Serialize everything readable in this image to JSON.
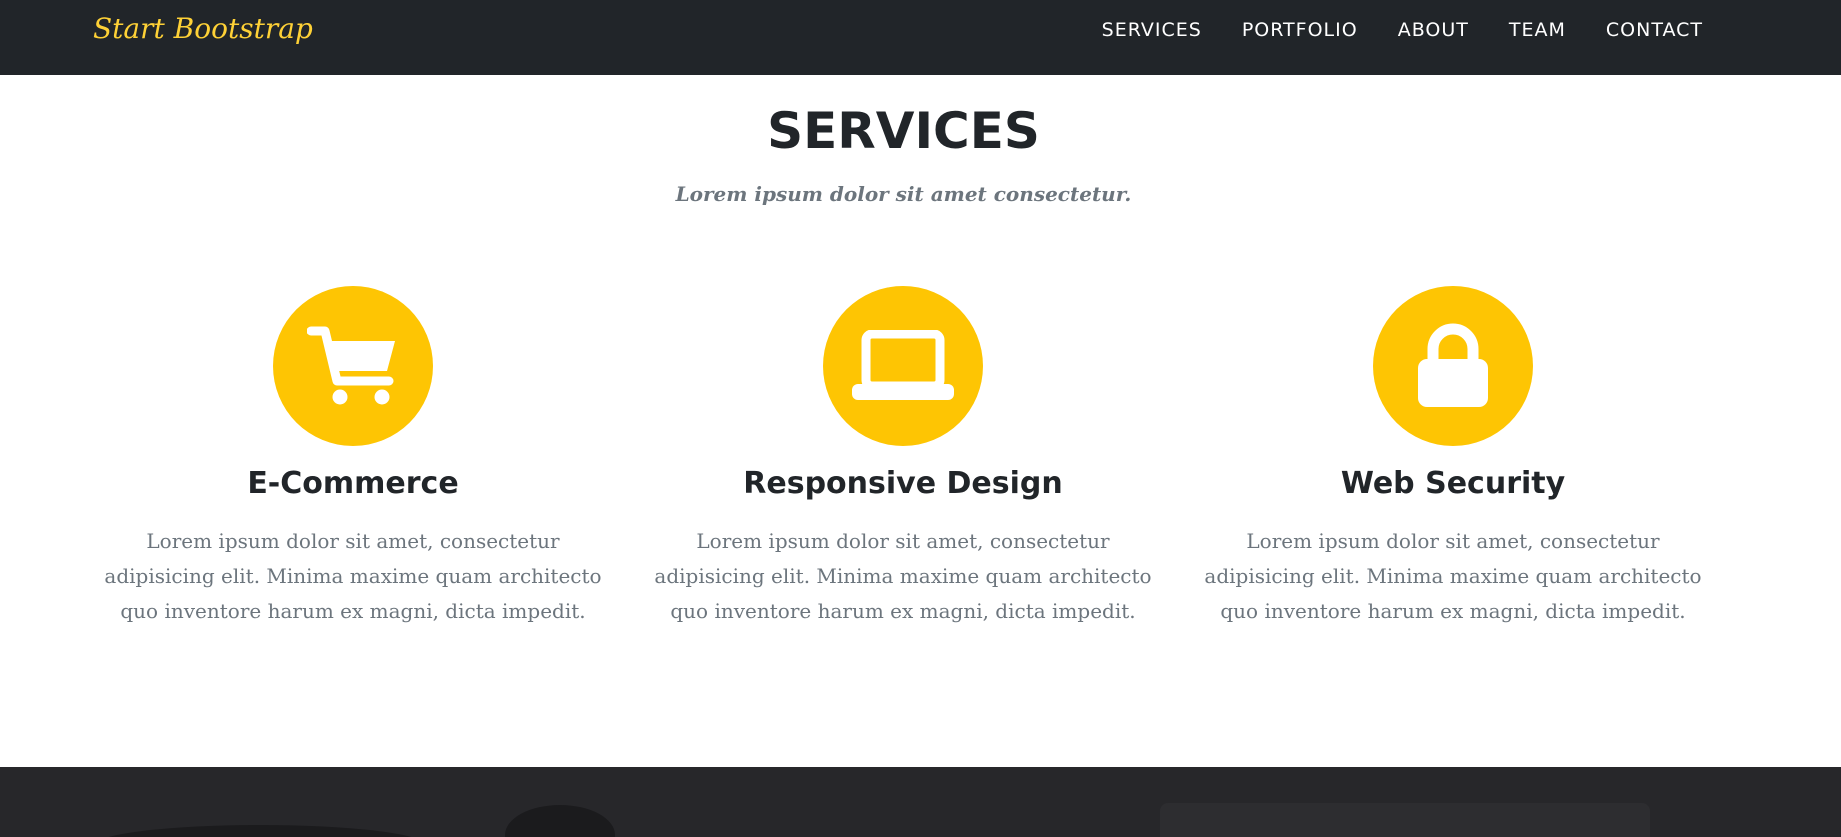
{
  "navbar": {
    "brand": "Start Bootstrap",
    "links": [
      "SERVICES",
      "PORTFOLIO",
      "ABOUT",
      "TEAM",
      "CONTACT"
    ]
  },
  "services": {
    "title": "SERVICES",
    "subtitle": "Lorem ipsum dolor sit amet consectetur.",
    "items": [
      {
        "icon": "shopping-cart-icon",
        "heading": "E-Commerce",
        "text": "Lorem ipsum dolor sit amet, consectetur adipisicing elit. Minima maxime quam architecto quo inventore harum ex magni, dicta impedit."
      },
      {
        "icon": "laptop-icon",
        "heading": "Responsive Design",
        "text": "Lorem ipsum dolor sit amet, consectetur adipisicing elit. Minima maxime quam architecto quo inventore harum ex magni, dicta impedit."
      },
      {
        "icon": "lock-icon",
        "heading": "Web Security",
        "text": "Lorem ipsum dolor sit amet, consectetur adipisicing elit. Minima maxime quam architecto quo inventore harum ex magni, dicta impedit."
      }
    ]
  },
  "colors": {
    "navbar_bg": "#212529",
    "brand_accent": "#fed136",
    "icon_circle": "#fec503",
    "heading_text": "#212529",
    "muted_text": "#6c757d"
  }
}
